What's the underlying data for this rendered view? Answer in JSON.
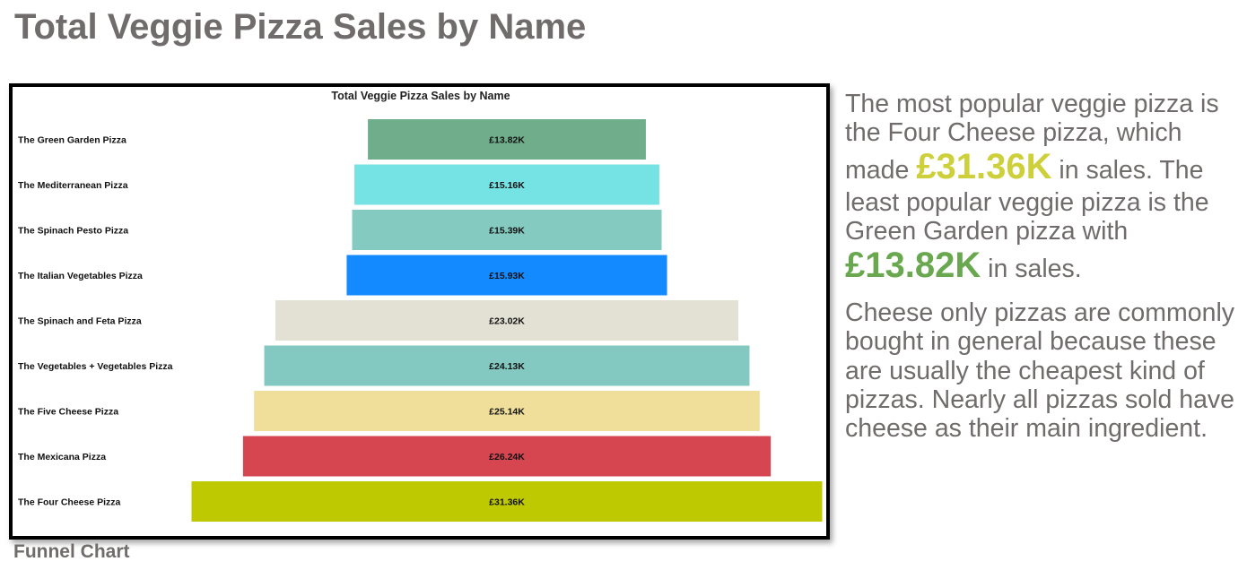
{
  "page": {
    "title": "Total Veggie Pizza Sales by Name",
    "caption": "Funnel Chart"
  },
  "insight": {
    "p1_part1": "The most popular veggie pizza is the Four Cheese pizza, which made ",
    "p1_value1": "£31.36K",
    "p1_part2": " in sales. The least popular veggie pizza is the Green Garden pizza with ",
    "p1_value2": "£13.82K",
    "p1_part3": " in sales.",
    "p2": "Cheese only pizzas are commonly bought in general because these are usually the cheapest kind of pizzas. Nearly all pizzas sold have cheese as their main ingredient.",
    "highlight_colors": {
      "max": "#cdd03a",
      "min": "#6aa84f"
    }
  },
  "chart_data": {
    "type": "funnel",
    "title": "Total Veggie Pizza Sales by Name",
    "categories": [
      "The Green Garden Pizza",
      "The Mediterranean Pizza",
      "The Spinach Pesto Pizza",
      "The Italian Vegetables Pizza",
      "The Spinach and Feta Pizza",
      "The Vegetables + Vegetables Pizza",
      "The Five Cheese Pizza",
      "The Mexicana Pizza",
      "The Four Cheese Pizza"
    ],
    "values": [
      13.82,
      15.16,
      15.39,
      15.93,
      23.02,
      24.13,
      25.14,
      26.24,
      31.36
    ],
    "value_labels": [
      "£13.82K",
      "£15.16K",
      "£15.39K",
      "£15.93K",
      "£23.02K",
      "£24.13K",
      "£25.14K",
      "£26.24K",
      "£31.36K"
    ],
    "unit": "£K",
    "colors": [
      "#6fad8b",
      "#75e2e3",
      "#85cac1",
      "#138aff",
      "#e3e0d4",
      "#84c9c1",
      "#efdf9a",
      "#d54651",
      "#bfc902"
    ]
  }
}
